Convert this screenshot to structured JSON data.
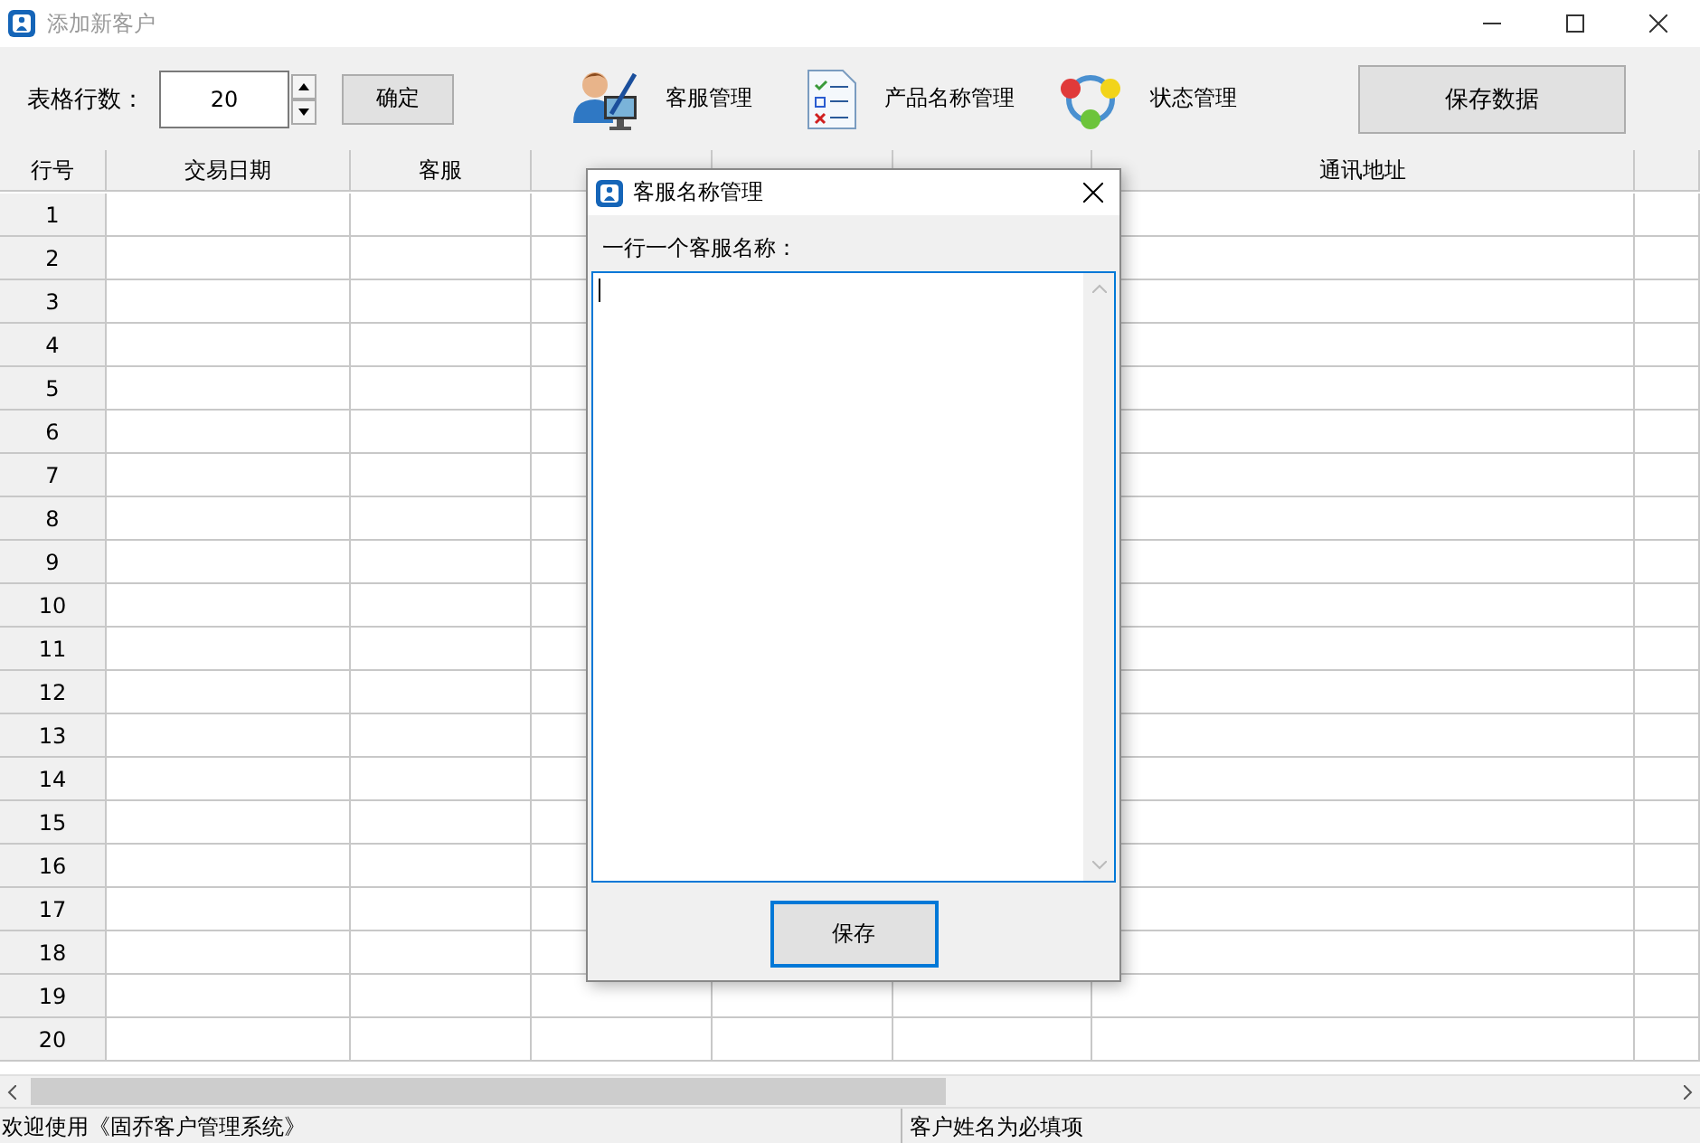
{
  "window": {
    "title": "添加新客户"
  },
  "toolbar": {
    "rows_label": "表格行数：",
    "rows_value": "20",
    "confirm_button": "确定",
    "tools": [
      {
        "label": "客服管理",
        "kind": "agent"
      },
      {
        "label": "产品名称管理",
        "kind": "list"
      },
      {
        "label": "状态管理",
        "kind": "cycle"
      }
    ],
    "save_button": "保存数据"
  },
  "table": {
    "columns": [
      {
        "kind": "text",
        "label": "行号"
      },
      {
        "kind": "text",
        "label": "交易日期"
      },
      {
        "kind": "text",
        "label": "客服"
      },
      {
        "kind": "covered"
      },
      {
        "kind": "covered"
      },
      {
        "kind": "covered"
      },
      {
        "kind": "text",
        "label": "通讯地址"
      }
    ],
    "rows": [
      "1",
      "2",
      "3",
      "4",
      "5",
      "6",
      "7",
      "8",
      "9",
      "10",
      "11",
      "12",
      "13",
      "14",
      "15",
      "16",
      "17",
      "18",
      "19",
      "20"
    ]
  },
  "dialog": {
    "title": "客服名称管理",
    "label": "一行一个客服名称：",
    "save_button": "保存"
  },
  "status_bar": [
    "欢迎使用《固乔客户管理系统》",
    "客户姓名为必填项"
  ]
}
